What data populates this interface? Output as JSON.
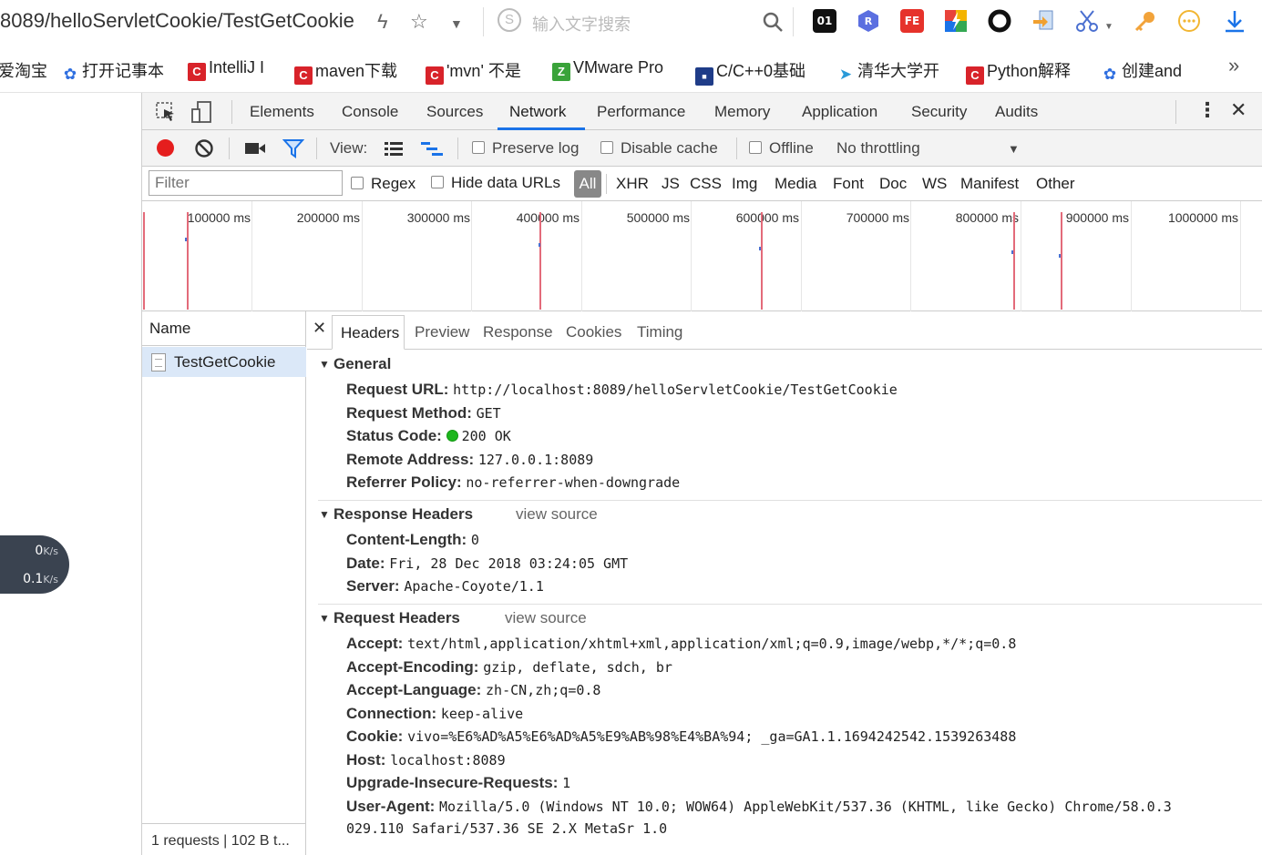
{
  "address_bar": {
    "url_visible": "8089/helloServletCookie/TestGetCookie",
    "search_placeholder": "输入文字搜索"
  },
  "bookmarks": [
    {
      "label": "爱淘宝",
      "icon": "none"
    },
    {
      "label": "打开记事本",
      "icon": "baidu-paw-icon"
    },
    {
      "label": "IntelliJ I",
      "icon": "csdn-icon"
    },
    {
      "label": "maven下载",
      "icon": "csdn-icon"
    },
    {
      "label": "'mvn' 不是",
      "icon": "csdn-icon"
    },
    {
      "label": "VMware Pro",
      "icon": "green-z-icon"
    },
    {
      "label": "C/C++0基础",
      "icon": "blue-badge-icon"
    },
    {
      "label": "清华大学开",
      "icon": "bird-icon"
    },
    {
      "label": "Python解释",
      "icon": "csdn-icon"
    },
    {
      "label": "创建and",
      "icon": "baidu-paw-icon"
    }
  ],
  "speed_widget": {
    "up": "0",
    "up_unit": "K/s",
    "down": "0.1",
    "down_unit": "K/s"
  },
  "devtools": {
    "tabs": [
      "Elements",
      "Console",
      "Sources",
      "Network",
      "Performance",
      "Memory",
      "Application",
      "Security",
      "Audits"
    ],
    "active_tab": "Network",
    "toolbar": {
      "view_label": "View:",
      "preserve_log": "Preserve log",
      "disable_cache": "Disable cache",
      "offline": "Offline",
      "throttling": "No throttling"
    },
    "filter": {
      "placeholder": "Filter",
      "regex": "Regex",
      "hide_data_urls": "Hide data URLs",
      "types": [
        "All",
        "XHR",
        "JS",
        "CSS",
        "Img",
        "Media",
        "Font",
        "Doc",
        "WS",
        "Manifest",
        "Other"
      ]
    },
    "overview_ticks": [
      "100000 ms",
      "200000 ms",
      "300000 ms",
      "400000 ms",
      "500000 ms",
      "600000 ms",
      "700000 ms",
      "800000 ms",
      "900000 ms",
      "1000000 ms"
    ],
    "name_header": "Name",
    "requests": [
      "TestGetCookie"
    ],
    "summary": "1 requests  |  102 B t...",
    "detail_tabs": [
      "Headers",
      "Preview",
      "Response",
      "Cookies",
      "Timing"
    ],
    "general": {
      "title": "General",
      "rows": [
        {
          "k": "Request URL:",
          "v": "http://localhost:8089/helloServletCookie/TestGetCookie"
        },
        {
          "k": "Request Method:",
          "v": "GET"
        },
        {
          "k": "Status Code:",
          "v": "200 OK"
        },
        {
          "k": "Remote Address:",
          "v": "127.0.0.1:8089"
        },
        {
          "k": "Referrer Policy:",
          "v": "no-referrer-when-downgrade"
        }
      ]
    },
    "response_headers": {
      "title": "Response Headers",
      "view_source": "view source",
      "rows": [
        {
          "k": "Content-Length:",
          "v": "0"
        },
        {
          "k": "Date:",
          "v": "Fri, 28 Dec 2018 03:24:05 GMT"
        },
        {
          "k": "Server:",
          "v": "Apache-Coyote/1.1"
        }
      ]
    },
    "request_headers": {
      "title": "Request Headers",
      "view_source": "view source",
      "rows": [
        {
          "k": "Accept:",
          "v": "text/html,application/xhtml+xml,application/xml;q=0.9,image/webp,*/*;q=0.8"
        },
        {
          "k": "Accept-Encoding:",
          "v": "gzip, deflate, sdch, br"
        },
        {
          "k": "Accept-Language:",
          "v": "zh-CN,zh;q=0.8"
        },
        {
          "k": "Connection:",
          "v": "keep-alive"
        },
        {
          "k": "Cookie:",
          "v": "vivo=%E6%AD%A5%E6%AD%A5%E9%AB%98%E4%BA%94; _ga=GA1.1.1694242542.1539263488"
        },
        {
          "k": "Host:",
          "v": "localhost:8089"
        },
        {
          "k": "Upgrade-Insecure-Requests:",
          "v": "1"
        },
        {
          "k": "User-Agent:",
          "v": "Mozilla/5.0 (Windows NT 10.0; WOW64) AppleWebKit/537.36 (KHTML, like Gecko) Chrome/58.0.3"
        },
        {
          "k": "",
          "v": "029.110 Safari/537.36 SE 2.X MetaSr 1.0"
        }
      ]
    }
  }
}
